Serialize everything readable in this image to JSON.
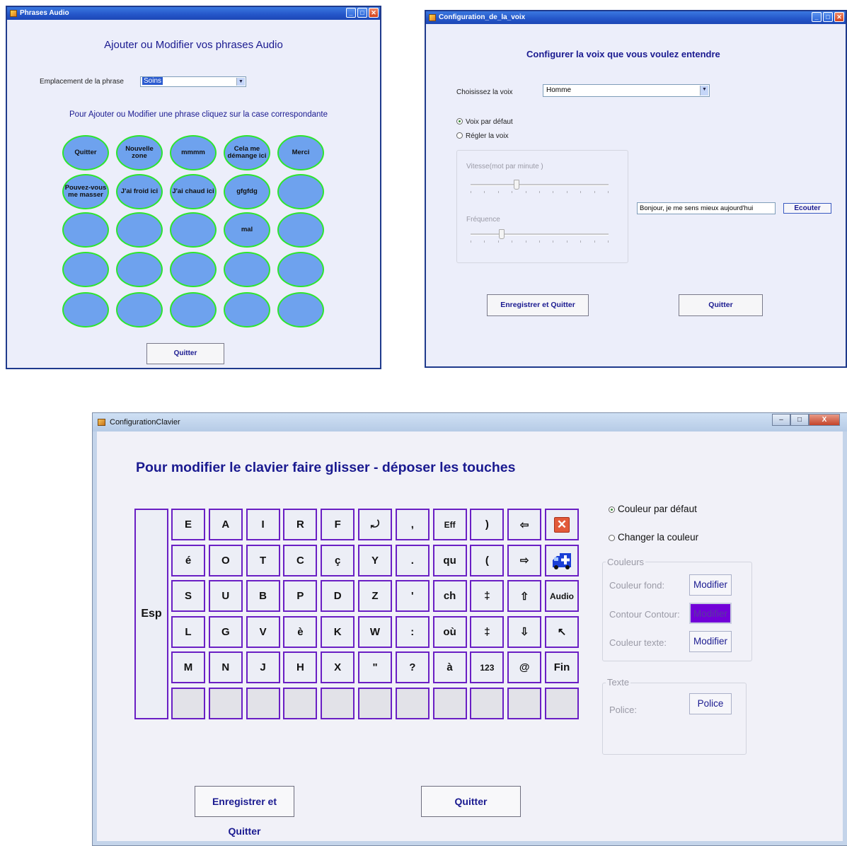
{
  "phrases_window": {
    "title": "Phrases Audio",
    "heading": "Ajouter ou Modifier vos phrases Audio",
    "location_label": "Emplacement de la phrase",
    "location_value": "Soins",
    "instruction": "Pour  Ajouter ou Modifier une phrase cliquez sur la case correspondante",
    "phrases": [
      [
        "Quitter",
        "Nouvelle zone",
        "mmmm",
        "Cela me démange ici",
        "Merci"
      ],
      [
        "Pouvez-vous me masser",
        "J'ai froid ici",
        "J'ai chaud ici",
        "gfgfdg",
        ""
      ],
      [
        "",
        "",
        "",
        "mal",
        ""
      ],
      [
        "",
        "",
        "",
        "",
        ""
      ],
      [
        "",
        "",
        "",
        "",
        ""
      ]
    ],
    "quit_label": "Quitter"
  },
  "voice_window": {
    "title": "Configuration_de_la_voix",
    "heading": "Configurer la voix que vous voulez entendre",
    "voice_label": "Choisissez la voix",
    "voice_value": "Homme",
    "radio_default": "Voix par défaut",
    "radio_adjust": "Régler la voix",
    "selected_radio": "default",
    "speed_label": "Vitesse(mot par minute )",
    "frequency_label": "Fréquence",
    "speed_level": 0.33,
    "frequency_level": 0.22,
    "test_phrase": "Bonjour, je me sens mieux aujourd'hui",
    "listen_label": "Ecouter",
    "save_quit_label": "Enregistrer et Quitter",
    "quit_label": "Quitter"
  },
  "keyboard_window": {
    "title": "ConfigurationClavier",
    "heading": "Pour modifier le clavier faire glisser - déposer les touches",
    "space_key": "Esp",
    "keys": [
      [
        "E",
        "A",
        "I",
        "R",
        "F",
        "⤾",
        ",",
        "Eff",
        ")",
        "⇦",
        "close-icon"
      ],
      [
        "é",
        "O",
        "T",
        "C",
        "ç",
        "Y",
        ".",
        "qu",
        "(",
        "⇨",
        "ambulance-icon"
      ],
      [
        "S",
        "U",
        "B",
        "P",
        "D",
        "Z",
        "'",
        "ch",
        "‡",
        "⇧",
        "Audio"
      ],
      [
        "L",
        "G",
        "V",
        "è",
        "K",
        "W",
        ":",
        "où",
        "‡",
        "⇩",
        "↖"
      ],
      [
        "M",
        "N",
        "J",
        "H",
        "X",
        "\"",
        "?",
        "à",
        "123",
        "@",
        "Fin"
      ],
      [
        "",
        "",
        "",
        "",
        "",
        "",
        "",
        "",
        "",
        "",
        ""
      ]
    ],
    "radio_default_color": "Couleur par défaut",
    "radio_change_color": "Changer la couleur",
    "colors_group": "Couleurs",
    "bg_color_label": "Couleur fond:",
    "outline_color_label": "Contour Contour:",
    "text_color_label": "Couleur texte:",
    "modify_label": "Modifier",
    "text_group": "Texte",
    "font_label": "Police:",
    "font_button": "Police",
    "save_quit_label": "Enregistrer et Quitter",
    "quit_label": "Quitter",
    "accent_color": "#6a1fc4",
    "outline_color": "#7200d8"
  }
}
